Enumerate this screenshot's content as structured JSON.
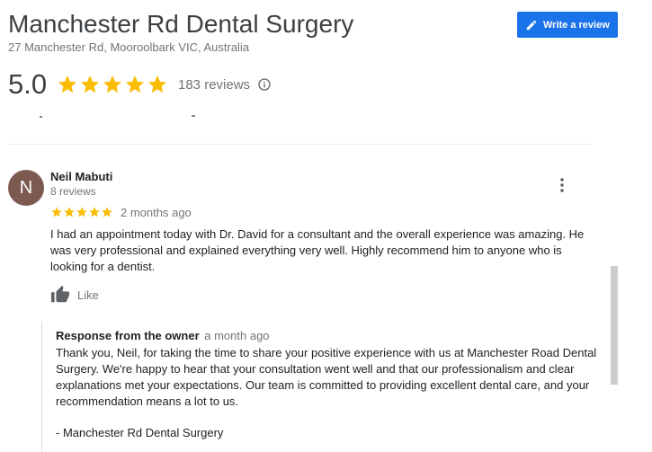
{
  "header": {
    "title": "Manchester Rd Dental Surgery",
    "address": "27 Manchester Rd, Mooroolbark VIC, Australia",
    "write_review_label": "Write a review"
  },
  "rating": {
    "value": "5.0",
    "stars": 5,
    "review_count_label": "183 reviews"
  },
  "review": {
    "avatar_letter": "N",
    "avatar_color": "#7d5a50",
    "reviewer_name": "Neil Mabuti",
    "reviewer_reviews": "8 reviews",
    "stars": 5,
    "date": "2 months ago",
    "text": "I had an appointment today with Dr. David for a consultant and the overall experience was amazing. He was very professional and explained everything very well. Highly recommend him to anyone who is looking for a dentist.",
    "like_label": "Like"
  },
  "owner_response": {
    "heading": "Response from the owner",
    "date": "a month ago",
    "text": "Thank you, Neil, for taking the time to share your positive experience with us at Manchester Road Dental Surgery. We're happy to hear that your consultation went well and that our professionalism and clear explanations met your expectations. Our team is committed to providing excellent dental care, and your recommendation means a lot to us.",
    "signature": "- Manchester Rd Dental Surgery"
  },
  "colors": {
    "accent": "#1a73e8",
    "star": "#fbbc04",
    "muted": "#70757a"
  },
  "icons": [
    "pencil-icon",
    "star-icon",
    "info-icon",
    "more-vert-icon",
    "thumb-up-icon"
  ]
}
